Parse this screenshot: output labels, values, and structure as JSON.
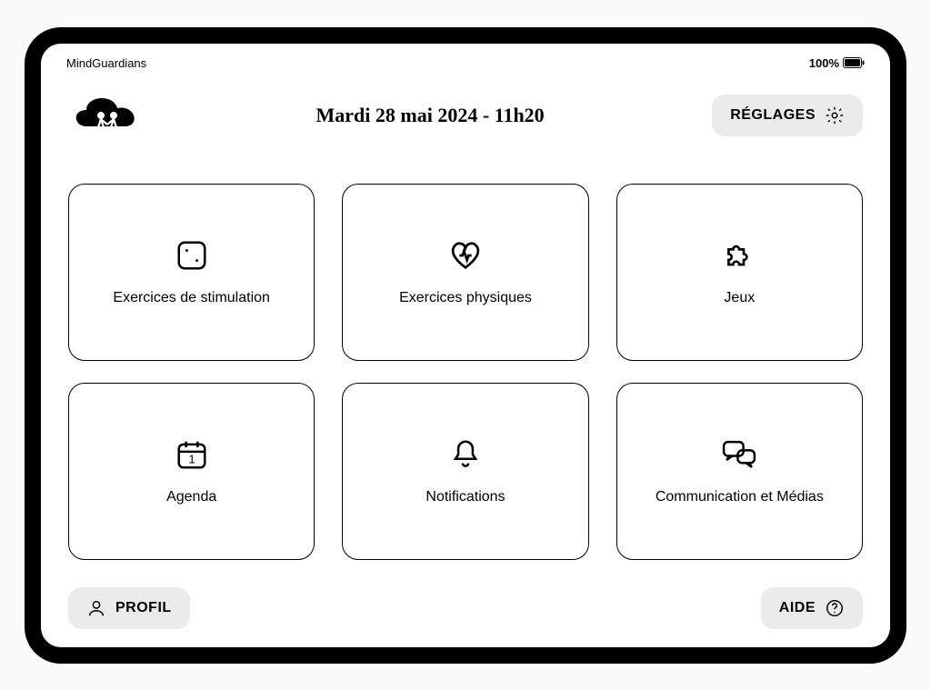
{
  "status_bar": {
    "app_name": "MindGuardians",
    "battery_pct": "100%"
  },
  "header": {
    "date_time": "Mardi 28 mai 2024 - 11h20",
    "settings_label": "RÉGLAGES"
  },
  "cards": [
    {
      "label": "Exercices de stimulation",
      "icon": "dice"
    },
    {
      "label": "Exercices physiques",
      "icon": "heart"
    },
    {
      "label": "Jeux",
      "icon": "puzzle"
    },
    {
      "label": "Agenda",
      "icon": "calendar"
    },
    {
      "label": "Notifications",
      "icon": "bell"
    },
    {
      "label": "Communication et Médias",
      "icon": "chat"
    }
  ],
  "footer": {
    "profile_label": "PROFIL",
    "help_label": "AIDE"
  }
}
